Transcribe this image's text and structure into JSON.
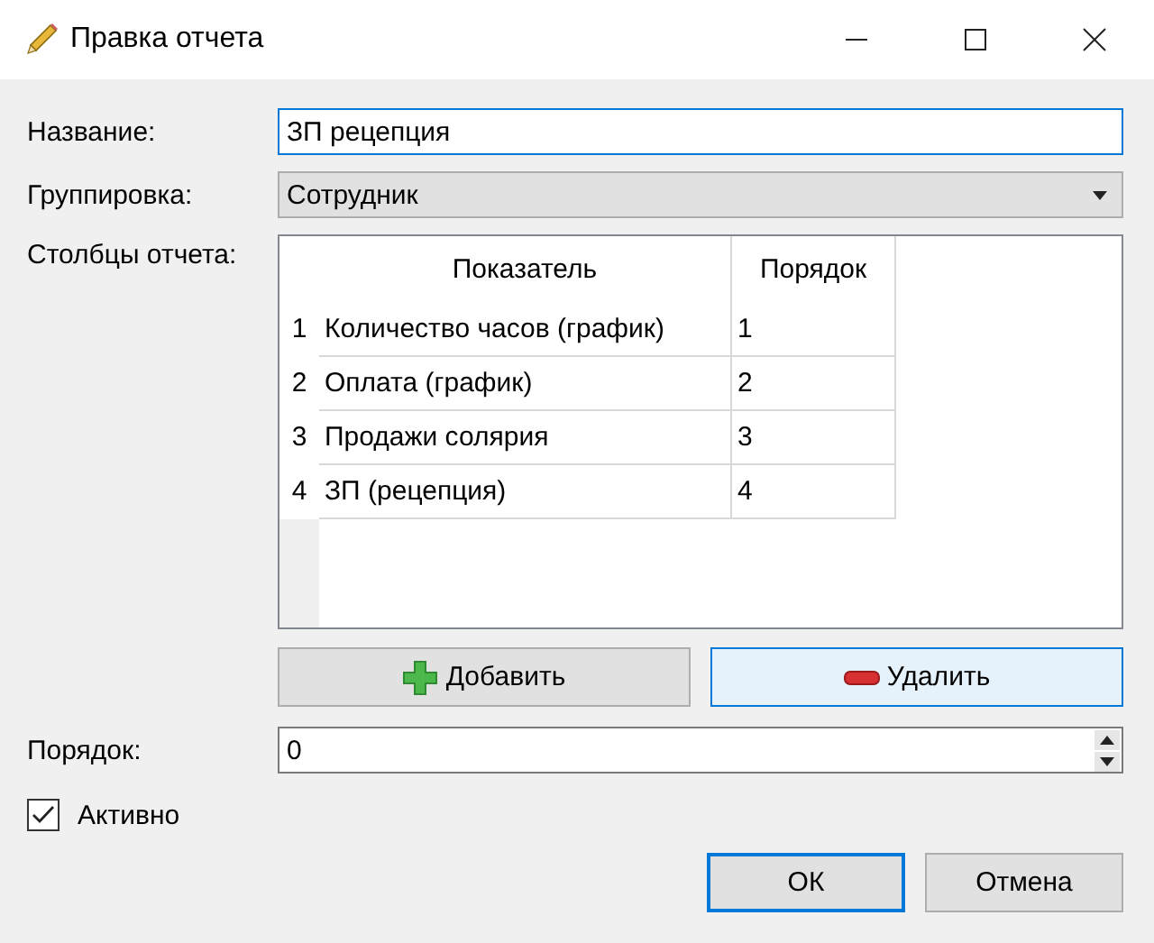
{
  "window": {
    "title": "Правка отчета"
  },
  "name_field": {
    "label": "Название:",
    "value": "ЗП рецепция",
    "focused": true
  },
  "grouping": {
    "label": "Группировка:",
    "value": "Сотрудник"
  },
  "columns_table": {
    "label": "Столбцы отчета:",
    "columns": [
      "Показатель",
      "Порядок"
    ],
    "rows": [
      {
        "number": "1",
        "cells": [
          "Количество часов (график)",
          "1"
        ]
      },
      {
        "number": "2",
        "cells": [
          "Оплата (график)",
          "2"
        ]
      },
      {
        "number": "3",
        "cells": [
          "Продажи солярия",
          "3"
        ]
      },
      {
        "number": "4",
        "cells": [
          "ЗП (рецепция)",
          "4"
        ]
      }
    ]
  },
  "table_buttons": [
    {
      "kind": "add",
      "label": "Добавить",
      "focused": false
    },
    {
      "kind": "remove",
      "label": "Удалить",
      "focused": true
    }
  ],
  "order_field": {
    "label": "Порядок:",
    "value": "0"
  },
  "active": {
    "label": "Активно",
    "checked": true
  },
  "buttons": [
    {
      "label": "ОК",
      "focused": true
    },
    {
      "label": "Отмена",
      "focused": false
    }
  ]
}
